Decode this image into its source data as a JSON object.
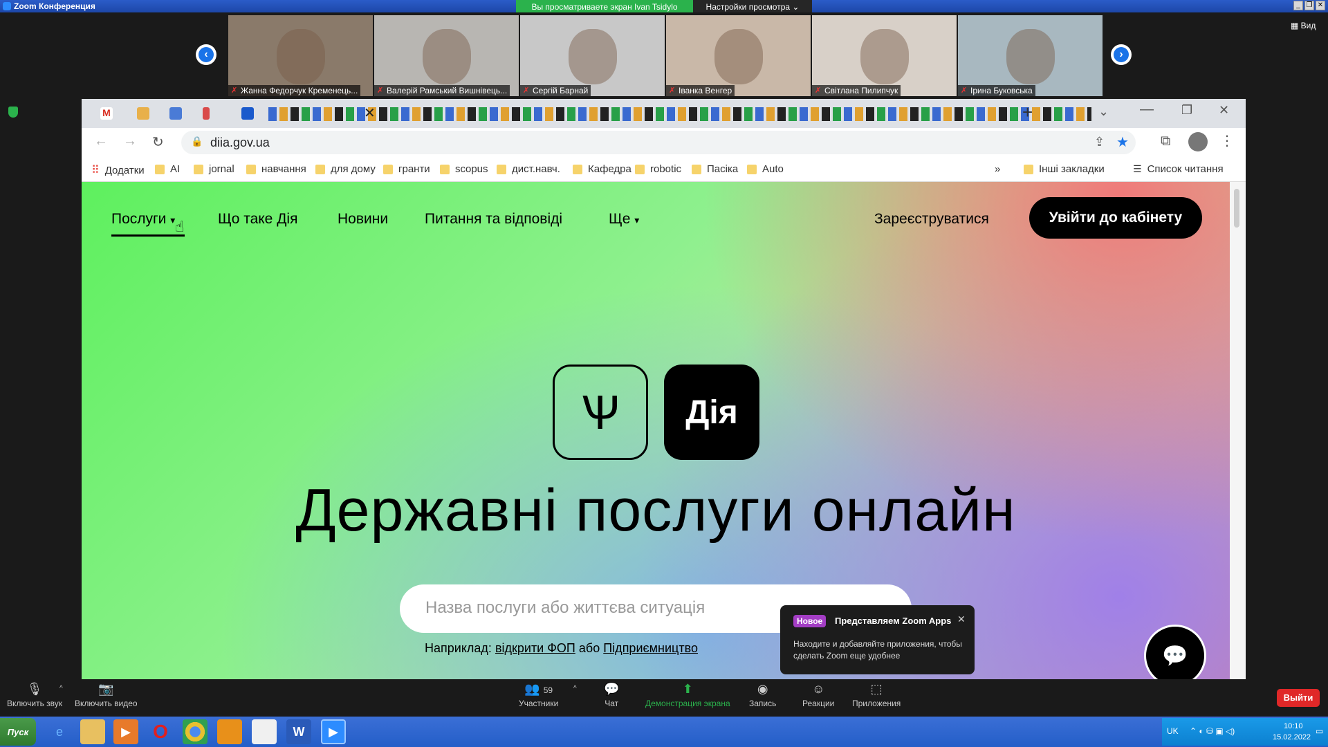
{
  "zoom": {
    "title": "Zoom Конференция",
    "viewing_banner": "Вы просматриваете экран Ivan Tsidylo",
    "view_options": "Настройки просмотра ⌄",
    "view_label": "Вид",
    "participants": [
      {
        "name": "Жанна Федорчук Кременець...",
        "bg": "#8a7a6a"
      },
      {
        "name": "Валерій Рамський Вишнівець...",
        "bg": "#b8b6b2"
      },
      {
        "name": "Сергій Барнай",
        "bg": "#c8c8c8"
      },
      {
        "name": "Іванка Венгер",
        "bg": "#c9b8a8"
      },
      {
        "name": "Світлана Пилипчук",
        "bg": "#d8d0c8"
      },
      {
        "name": "Ірина Буковська",
        "bg": "#a8b8c0"
      }
    ],
    "controls": {
      "mute": "Включить звук",
      "video": "Включить видео",
      "participants": "Участники",
      "participants_count": "59",
      "chat": "Чат",
      "share": "Демонстрация экрана",
      "record": "Запись",
      "reactions": "Реакции",
      "apps": "Приложения",
      "leave": "Выйти"
    },
    "apps_popup": {
      "badge": "Новое",
      "title": "Представляем Zoom Apps",
      "body": "Находите и добавляйте приложения, чтобы сделать Zoom еще удобнее"
    }
  },
  "browser": {
    "url": "diia.gov.ua",
    "bookmarks": [
      {
        "label": "Додатки",
        "type": "apps"
      },
      {
        "label": "AI",
        "type": "folder"
      },
      {
        "label": "jornal",
        "type": "folder"
      },
      {
        "label": "навчання",
        "type": "folder"
      },
      {
        "label": "для дому",
        "type": "folder"
      },
      {
        "label": "гранти",
        "type": "folder"
      },
      {
        "label": "scopus",
        "type": "folder"
      },
      {
        "label": "дист.навч.",
        "type": "folder"
      },
      {
        "label": "Кафедра",
        "type": "folder"
      },
      {
        "label": "robotic",
        "type": "folder"
      },
      {
        "label": "Пасіка",
        "type": "folder"
      },
      {
        "label": "Auto",
        "type": "folder"
      }
    ],
    "bookmarks_more": "»",
    "other_bookmarks": "Інші закладки",
    "reading_list": "Список читання"
  },
  "diia": {
    "nav": {
      "services": "Послуги",
      "what_is": "Що таке Дія",
      "news": "Новини",
      "faq": "Питання та відповіді",
      "more": "Ще",
      "register": "Зареєструватися",
      "login": "Увійти до кабінету"
    },
    "logo_text": "Дія",
    "hero_title": "Державні послуги онлайн",
    "search_placeholder": "Назва послуги або життєва ситуація",
    "example_prefix": "Наприклад:",
    "example_link1": "відкрити ФОП",
    "example_or": "або",
    "example_link2": "Підприємництво"
  },
  "taskbar": {
    "start": "Пуск",
    "lang": "UK",
    "time": "10:10",
    "date": "15.02.2022"
  },
  "colors": {
    "zoom_green": "#2bb24c",
    "zoom_blue": "#2d8cff",
    "leave_red": "#e02828",
    "bookmark_star": "#1a73e8"
  }
}
